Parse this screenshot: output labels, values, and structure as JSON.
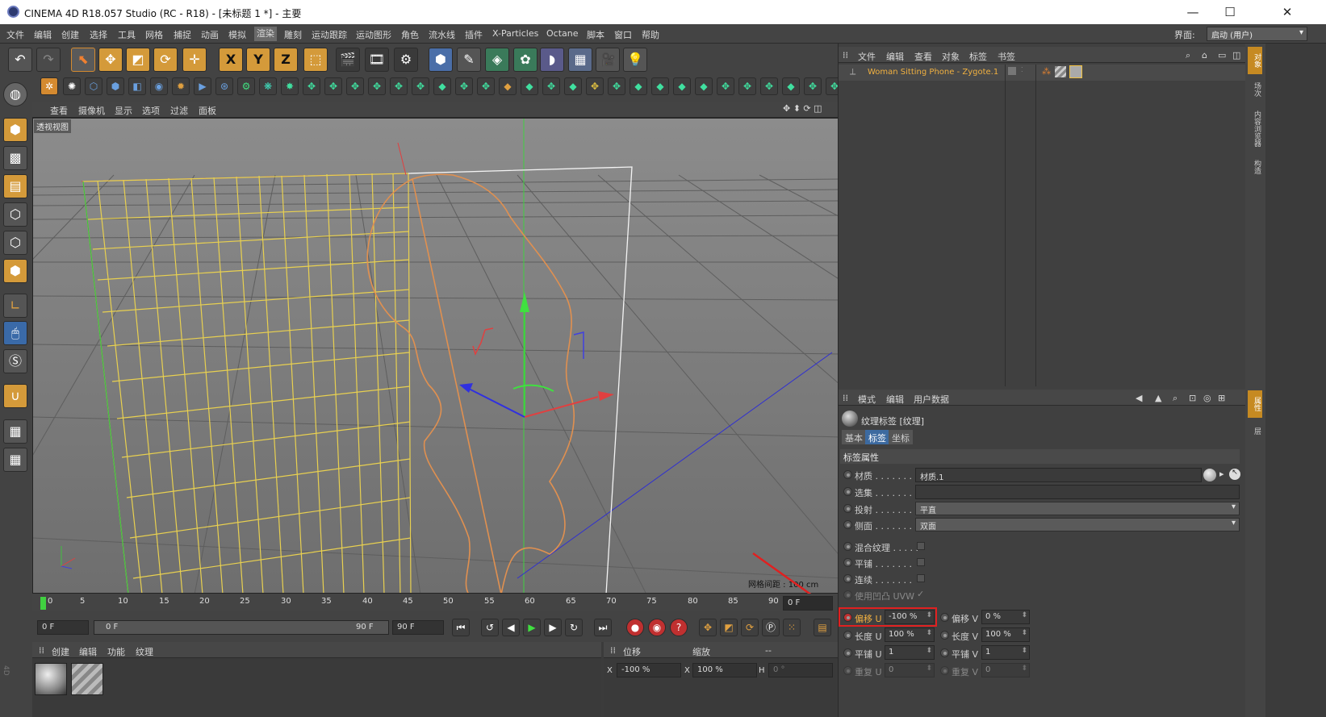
{
  "window": {
    "title": "CINEMA 4D R18.057 Studio (RC - R18) - [未标题 1 *] - 主要",
    "minimize": "—",
    "maximize": "☐",
    "close": "✕"
  },
  "menubar": {
    "items": [
      "文件",
      "编辑",
      "创建",
      "选择",
      "工具",
      "网格",
      "捕捉",
      "动画",
      "模拟",
      "渲染",
      "雕刻",
      "运动跟踪",
      "运动图形",
      "角色",
      "流水线",
      "插件",
      "X-Particles",
      "Octane",
      "脚本",
      "窗口",
      "帮助"
    ],
    "selected": "渲染",
    "layout_label": "界面:",
    "layout_value": "启动 (用户)"
  },
  "toolbar1": {
    "icons": [
      "undo-icon",
      "redo-icon",
      "live-select-icon",
      "move-icon",
      "scale-icon",
      "rotate-icon",
      "last-tool-icon",
      "x-axis-icon",
      "y-axis-icon",
      "z-axis-icon",
      "world-coord-icon",
      "render-view-icon",
      "render-picture-viewer-icon",
      "render-settings-icon",
      "cube-icon",
      "pen-icon",
      "subdivision-icon",
      "array-icon",
      "deformer-icon",
      "floor-icon",
      "camera-icon",
      "light-icon"
    ],
    "axis_x": "X",
    "axis_y": "Y",
    "axis_z": "Z"
  },
  "viewport": {
    "menu": [
      "查看",
      "摄像机",
      "显示",
      "选项",
      "过滤",
      "面板"
    ],
    "label": "透视视图",
    "grid_spacing": "网格间距 : 100 cm"
  },
  "timeline": {
    "ticks": [
      "0",
      "5",
      "10",
      "15",
      "20",
      "25",
      "30",
      "35",
      "40",
      "45",
      "50",
      "55",
      "60",
      "65",
      "70",
      "75",
      "80",
      "85",
      "90"
    ],
    "current_frame": "0 F"
  },
  "transport": {
    "start": "0 F",
    "range_start": "0 F",
    "range_end": "90 F",
    "end": "90 F"
  },
  "material_manager": {
    "menu": [
      "创建",
      "编辑",
      "功能",
      "纹理"
    ]
  },
  "coord_manager": {
    "col1": "位移",
    "col2": "缩放",
    "col3": "--",
    "x_label": "X",
    "x_pos": "-100 %",
    "x_label2": "X",
    "x_scale": "100 %",
    "h_label": "H",
    "h_val": "0 °"
  },
  "object_manager": {
    "menu": [
      "文件",
      "编辑",
      "查看",
      "对象",
      "标签",
      "书签"
    ],
    "object_name": "Woman Sitting Phone - Zygote.1"
  },
  "attribute_manager": {
    "menu": [
      "模式",
      "编辑",
      "用户数据"
    ],
    "title": "纹理标签 [纹理]",
    "tabs": [
      "基本",
      "标签",
      "坐标"
    ],
    "active_tab": "标签",
    "section": "标签属性",
    "material_label": "材质 . . . . . . .",
    "material_value": "材质.1",
    "selection_label": "选集 . . . . . . .",
    "projection_label": "投射 . . . . . . .",
    "projection_value": "平直",
    "side_label": "侧面 . . . . . . .",
    "side_value": "双面",
    "mix_label": "混合纹理 . . . . .",
    "tile_label": "平铺 . . . . . . .",
    "seamless_label": "连续 . . . . . . .",
    "bump_label": "使用凹凸 UVW",
    "offset_u_label": "偏移 U",
    "offset_u": "-100 %",
    "offset_v_label": "偏移 V",
    "offset_v": "0 %",
    "length_u_label": "长度 U",
    "length_u": "100 %",
    "length_v_label": "长度 V",
    "length_v": "100 %",
    "tiles_u_label": "平铺 U",
    "tiles_u": "1",
    "tiles_v_label": "平铺 V",
    "tiles_v": "1",
    "repeat_u_label": "重复 U",
    "repeat_u": "0",
    "repeat_v_label": "重复 V",
    "repeat_v": "0"
  },
  "right_tabs": [
    "对象",
    "场次",
    "内容浏览器",
    "构造",
    "属性",
    "层"
  ],
  "colors": {
    "accent": "#d48a30",
    "highlight_box": "#e02020",
    "selected_object": "#f0b040"
  }
}
